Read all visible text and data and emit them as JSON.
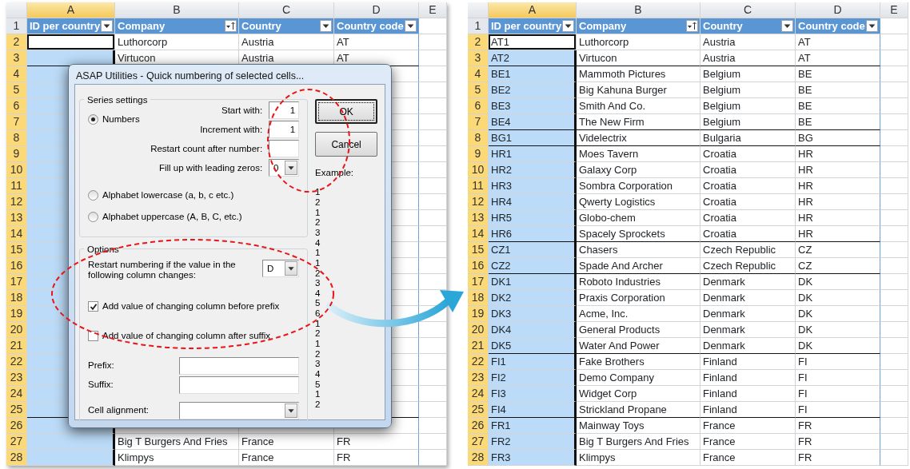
{
  "left_sheet": {
    "columns": [
      {
        "letter": "A",
        "selected": true
      },
      {
        "letter": "B",
        "selected": false
      },
      {
        "letter": "C",
        "selected": false
      },
      {
        "letter": "D",
        "selected": false
      },
      {
        "letter": "E",
        "selected": false
      }
    ],
    "header_row_number": "1",
    "headers": [
      {
        "label": "ID per country",
        "kind": "filter"
      },
      {
        "label": "Company",
        "kind": "sort"
      },
      {
        "label": "Country",
        "kind": "filter"
      },
      {
        "label": "Country code",
        "kind": "filter"
      }
    ],
    "rows": [
      {
        "number": "2",
        "company": "Luthorcorp",
        "country": "Austria",
        "code": "AT",
        "selected": true,
        "active": true,
        "border_below": false
      },
      {
        "number": "3",
        "company": "Virtucon",
        "country": "Austria",
        "code": "AT",
        "selected": true,
        "active": false,
        "border_below": true
      },
      {
        "number": "4",
        "selected": true,
        "active": false,
        "border_below": false
      },
      {
        "number": "5",
        "selected": true,
        "active": false,
        "border_below": false
      },
      {
        "number": "6",
        "selected": true,
        "active": false,
        "border_below": false
      },
      {
        "number": "7",
        "selected": true,
        "active": false,
        "border_below": false
      },
      {
        "number": "8",
        "selected": true,
        "active": false,
        "border_below": false
      },
      {
        "number": "9",
        "selected": true,
        "active": false,
        "border_below": false
      },
      {
        "number": "10",
        "selected": true,
        "active": false,
        "border_below": false
      },
      {
        "number": "11",
        "selected": true,
        "active": false,
        "border_below": false
      },
      {
        "number": "12",
        "selected": true,
        "active": false,
        "border_below": false
      },
      {
        "number": "13",
        "selected": true,
        "active": false,
        "border_below": false
      },
      {
        "number": "14",
        "selected": true,
        "active": false,
        "border_below": false
      },
      {
        "number": "15",
        "selected": true,
        "active": false,
        "border_below": false
      },
      {
        "number": "16",
        "selected": true,
        "active": false,
        "border_below": false
      },
      {
        "number": "17",
        "selected": true,
        "active": false,
        "border_below": false
      },
      {
        "number": "18",
        "selected": true,
        "active": false,
        "border_below": false
      },
      {
        "number": "19",
        "selected": true,
        "active": false,
        "border_below": false
      },
      {
        "number": "20",
        "selected": true,
        "active": false,
        "border_below": false
      },
      {
        "number": "21",
        "selected": true,
        "active": false,
        "border_below": false
      },
      {
        "number": "22",
        "selected": true,
        "active": false,
        "border_below": false
      },
      {
        "number": "23",
        "selected": true,
        "active": false,
        "border_below": false
      },
      {
        "number": "24",
        "selected": true,
        "active": false,
        "border_below": false
      },
      {
        "number": "25",
        "selected": true,
        "active": false,
        "border_below": true
      },
      {
        "number": "26",
        "selected": true,
        "active": false,
        "border_below": false
      },
      {
        "number": "27",
        "company": "Big T Burgers And Fries",
        "country": "France",
        "code": "FR",
        "selected": true,
        "active": false,
        "border_below": false
      },
      {
        "number": "28",
        "company": "Klimpys",
        "country": "France",
        "code": "FR",
        "selected": true,
        "active": false,
        "border_below": false
      }
    ]
  },
  "dialog": {
    "title": "ASAP Utilities - Quick numbering of selected cells...",
    "series_group": {
      "legend": "Series settings",
      "types": [
        {
          "label": "Numbers",
          "selected": true
        },
        {
          "label": "Alphabet lowercase (a, b, c etc.)",
          "selected": false
        },
        {
          "label": "Alphabet uppercase (A, B, C, etc.)",
          "selected": false
        }
      ],
      "fields": [
        {
          "label": "Start with:",
          "kind": "text",
          "value": "1"
        },
        {
          "label": "Increment with:",
          "kind": "text",
          "value": "1"
        },
        {
          "label": "Restart count after number:",
          "kind": "text"
        },
        {
          "label": "Fill up with leading zeros:",
          "kind": "dropdown",
          "value": "0"
        }
      ]
    },
    "options_group": {
      "legend": "Options",
      "restart_label": "Restart numbering if the value in the following column changes:",
      "restart_column": "D",
      "checkboxes": [
        {
          "label": "Add value of changing column before prefix",
          "checked": true
        },
        {
          "label": "Add value of changing column after suffix",
          "checked": false
        }
      ],
      "fields": [
        {
          "label": "Prefix:",
          "kind": "text"
        },
        {
          "label": "Suffix:",
          "kind": "text"
        },
        {
          "label": "Cell alignment:",
          "kind": "dropdown"
        }
      ]
    },
    "buttons": [
      {
        "label": "OK",
        "default": true
      },
      {
        "label": "Cancel",
        "default": false
      }
    ],
    "example_label": "Example:",
    "example_values": [
      "1",
      "2",
      "1",
      "2",
      "3",
      "4",
      "1",
      "1",
      "2",
      "3",
      "4",
      "5",
      "6",
      "1",
      "2",
      "1",
      "2",
      "3",
      "4",
      "5",
      "1",
      "2"
    ]
  },
  "right_sheet": {
    "columns": [
      {
        "letter": "A",
        "selected": true
      },
      {
        "letter": "B",
        "selected": false
      },
      {
        "letter": "C",
        "selected": false
      },
      {
        "letter": "D",
        "selected": false
      },
      {
        "letter": "E",
        "selected": false
      }
    ],
    "header_row_number": "1",
    "headers": [
      {
        "label": "ID per country",
        "kind": "filter"
      },
      {
        "label": "Company",
        "kind": "sort"
      },
      {
        "label": "Country",
        "kind": "filter"
      },
      {
        "label": "Country code",
        "kind": "filter"
      }
    ],
    "rows": [
      {
        "number": "2",
        "id": "AT1",
        "company": "Luthorcorp",
        "country": "Austria",
        "code": "AT",
        "selected": true,
        "active": true,
        "border_below": false
      },
      {
        "number": "3",
        "id": "AT2",
        "company": "Virtucon",
        "country": "Austria",
        "code": "AT",
        "selected": true,
        "active": false,
        "border_below": true
      },
      {
        "number": "4",
        "id": "BE1",
        "company": "Mammoth Pictures",
        "country": "Belgium",
        "code": "BE",
        "selected": true,
        "active": false,
        "border_below": false
      },
      {
        "number": "5",
        "id": "BE2",
        "company": "Big Kahuna Burger",
        "country": "Belgium",
        "code": "BE",
        "selected": true,
        "active": false,
        "border_below": false
      },
      {
        "number": "6",
        "id": "BE3",
        "company": "Smith And Co.",
        "country": "Belgium",
        "code": "BE",
        "selected": true,
        "active": false,
        "border_below": false
      },
      {
        "number": "7",
        "id": "BE4",
        "company": "The New Firm",
        "country": "Belgium",
        "code": "BE",
        "selected": true,
        "active": false,
        "border_below": true
      },
      {
        "number": "8",
        "id": "BG1",
        "company": "Videlectrix",
        "country": "Bulgaria",
        "code": "BG",
        "selected": true,
        "active": false,
        "border_below": true
      },
      {
        "number": "9",
        "id": "HR1",
        "company": "Moes Tavern",
        "country": "Croatia",
        "code": "HR",
        "selected": true,
        "active": false,
        "border_below": false
      },
      {
        "number": "10",
        "id": "HR2",
        "company": "Galaxy Corp",
        "country": "Croatia",
        "code": "HR",
        "selected": true,
        "active": false,
        "border_below": false
      },
      {
        "number": "11",
        "id": "HR3",
        "company": "Sombra Corporation",
        "country": "Croatia",
        "code": "HR",
        "selected": true,
        "active": false,
        "border_below": false
      },
      {
        "number": "12",
        "id": "HR4",
        "company": "Qwerty Logistics",
        "country": "Croatia",
        "code": "HR",
        "selected": true,
        "active": false,
        "border_below": false
      },
      {
        "number": "13",
        "id": "HR5",
        "company": "Globo-chem",
        "country": "Croatia",
        "code": "HR",
        "selected": true,
        "active": false,
        "border_below": false
      },
      {
        "number": "14",
        "id": "HR6",
        "company": "Spacely Sprockets",
        "country": "Croatia",
        "code": "HR",
        "selected": true,
        "active": false,
        "border_below": true
      },
      {
        "number": "15",
        "id": "CZ1",
        "company": "Chasers",
        "country": "Czech Republic",
        "code": "CZ",
        "selected": true,
        "active": false,
        "border_below": false
      },
      {
        "number": "16",
        "id": "CZ2",
        "company": "Spade And Archer",
        "country": "Czech Republic",
        "code": "CZ",
        "selected": true,
        "active": false,
        "border_below": true
      },
      {
        "number": "17",
        "id": "DK1",
        "company": "Roboto Industries",
        "country": "Denmark",
        "code": "DK",
        "selected": true,
        "active": false,
        "border_below": false
      },
      {
        "number": "18",
        "id": "DK2",
        "company": "Praxis Corporation",
        "country": "Denmark",
        "code": "DK",
        "selected": true,
        "active": false,
        "border_below": false
      },
      {
        "number": "19",
        "id": "DK3",
        "company": "Acme, Inc.",
        "country": "Denmark",
        "code": "DK",
        "selected": true,
        "active": false,
        "border_below": false
      },
      {
        "number": "20",
        "id": "DK4",
        "company": "General Products",
        "country": "Denmark",
        "code": "DK",
        "selected": true,
        "active": false,
        "border_below": false
      },
      {
        "number": "21",
        "id": "DK5",
        "company": "Water And Power",
        "country": "Denmark",
        "code": "DK",
        "selected": true,
        "active": false,
        "border_below": true
      },
      {
        "number": "22",
        "id": "FI1",
        "company": "Fake Brothers",
        "country": "Finland",
        "code": "FI",
        "selected": true,
        "active": false,
        "border_below": false
      },
      {
        "number": "23",
        "id": "FI2",
        "company": "Demo Company",
        "country": "Finland",
        "code": "FI",
        "selected": true,
        "active": false,
        "border_below": false
      },
      {
        "number": "24",
        "id": "FI3",
        "company": "Widget Corp",
        "country": "Finland",
        "code": "FI",
        "selected": true,
        "active": false,
        "border_below": false
      },
      {
        "number": "25",
        "id": "FI4",
        "company": "Strickland Propane",
        "country": "Finland",
        "code": "FI",
        "selected": true,
        "active": false,
        "border_below": true
      },
      {
        "number": "26",
        "id": "FR1",
        "company": "Mainway Toys",
        "country": "France",
        "code": "FR",
        "selected": true,
        "active": false,
        "border_below": false
      },
      {
        "number": "27",
        "id": "FR2",
        "company": "Big T Burgers And Fries",
        "country": "France",
        "code": "FR",
        "selected": true,
        "active": false,
        "border_below": false
      },
      {
        "number": "28",
        "id": "FR3",
        "company": "Klimpys",
        "country": "France",
        "code": "FR",
        "selected": true,
        "active": false,
        "border_below": false
      }
    ]
  }
}
